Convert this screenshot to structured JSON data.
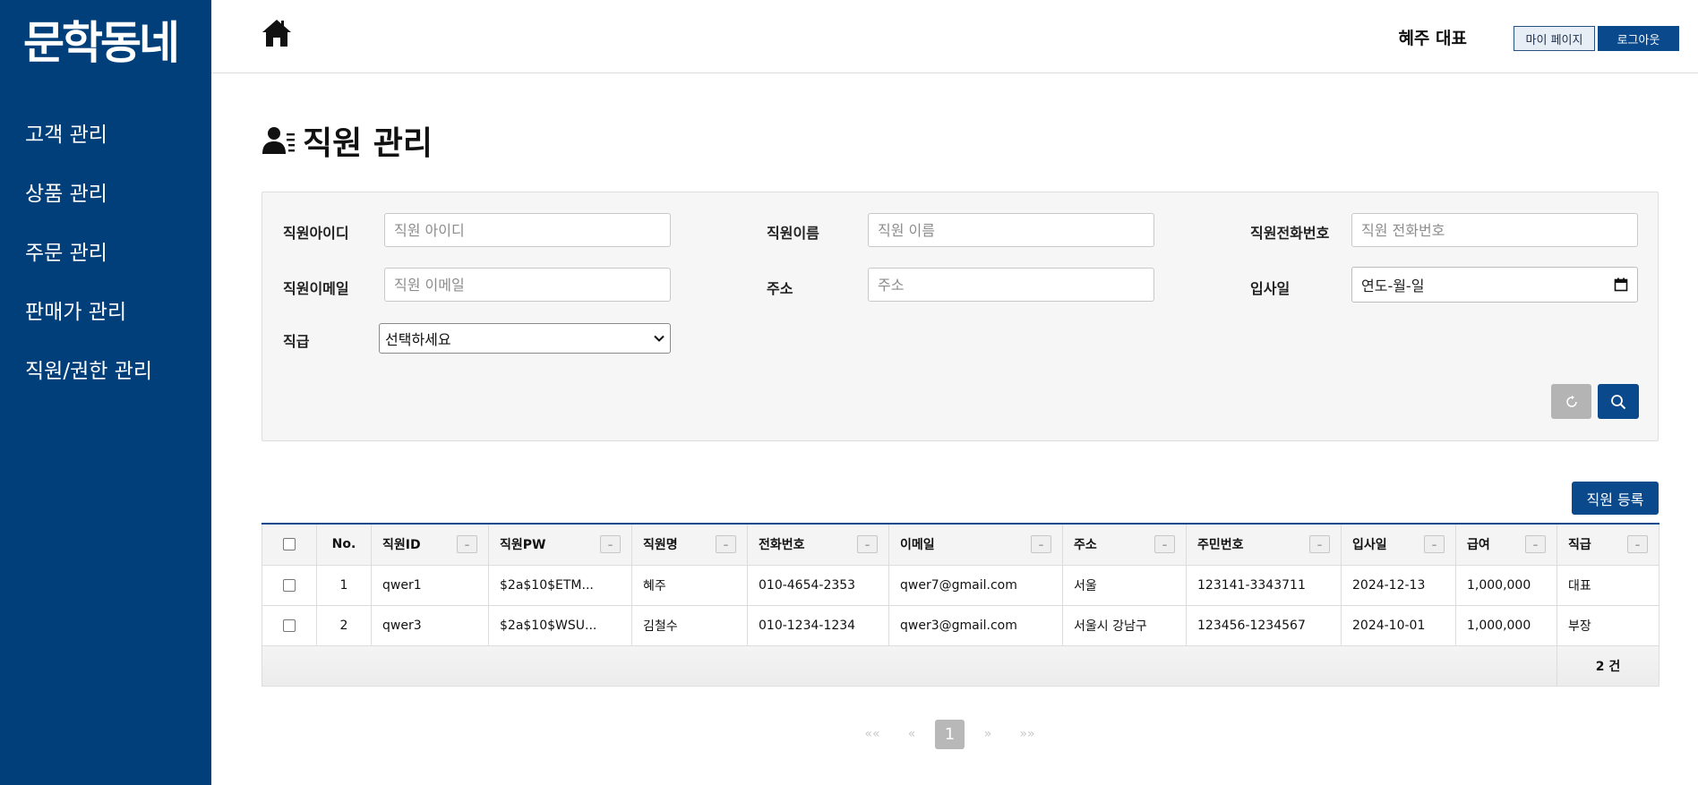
{
  "sidebar": {
    "logo": "문학동네",
    "items": [
      {
        "label": "고객 관리"
      },
      {
        "label": "상품 관리"
      },
      {
        "label": "주문 관리"
      },
      {
        "label": "판매가 관리"
      },
      {
        "label": "직원/권한 관리"
      }
    ]
  },
  "header": {
    "home_icon": "home-icon",
    "user_name": "혜주 대표",
    "mypage_label": "마이 페이지",
    "logout_label": "로그아웃"
  },
  "page": {
    "title": "직원 관리",
    "title_icon": "user-list-icon"
  },
  "filters": {
    "emp_id": {
      "label": "직원아이디",
      "placeholder": "직원 아이디",
      "value": ""
    },
    "emp_name": {
      "label": "직원이름",
      "placeholder": "직원 이름",
      "value": ""
    },
    "emp_phone": {
      "label": "직원전화번호",
      "placeholder": "직원 전화번호",
      "value": ""
    },
    "emp_email": {
      "label": "직원이메일",
      "placeholder": "직원 이메일",
      "value": ""
    },
    "address": {
      "label": "주소",
      "placeholder": "주소",
      "value": ""
    },
    "hire_date": {
      "label": "입사일",
      "placeholder": "연도-월-일"
    },
    "rank": {
      "label": "직급",
      "selected": "선택하세요"
    },
    "reset_icon": "refresh-icon",
    "search_icon": "search-icon"
  },
  "actions": {
    "register_label": "직원 등록"
  },
  "table": {
    "columns": [
      "No.",
      "직원ID",
      "직원PW",
      "직원명",
      "전화번호",
      "이메일",
      "주소",
      "주민번호",
      "입사일",
      "급여",
      "직급"
    ],
    "toggle_label": "–",
    "rows": [
      {
        "no": "1",
        "id": "qwer1",
        "pw": "$2a$10$ETM...",
        "name": "혜주",
        "phone": "010-4654-2353",
        "email": "qwer7@gmail.com",
        "address": "서울",
        "rrn": "123141-3343711",
        "hire_date": "2024-12-13",
        "salary": "1,000,000",
        "rank": "대표"
      },
      {
        "no": "2",
        "id": "qwer3",
        "pw": "$2a$10$WSU...",
        "name": "김철수",
        "phone": "010-1234-1234",
        "email": "qwer3@gmail.com",
        "address": "서울시 강남구",
        "rrn": "123456-1234567",
        "hire_date": "2024-10-01",
        "salary": "1,000,000",
        "rank": "부장"
      }
    ],
    "total_count": "2 건"
  },
  "pagination": {
    "first": "««",
    "prev": "«",
    "current": "1",
    "next": "»",
    "last": "»»"
  },
  "colors": {
    "sidebar_bg": "#003f7a",
    "primary": "#0a4a8c",
    "panel_bg": "#f6f6f6",
    "reset_button": "#b4b4b4"
  }
}
